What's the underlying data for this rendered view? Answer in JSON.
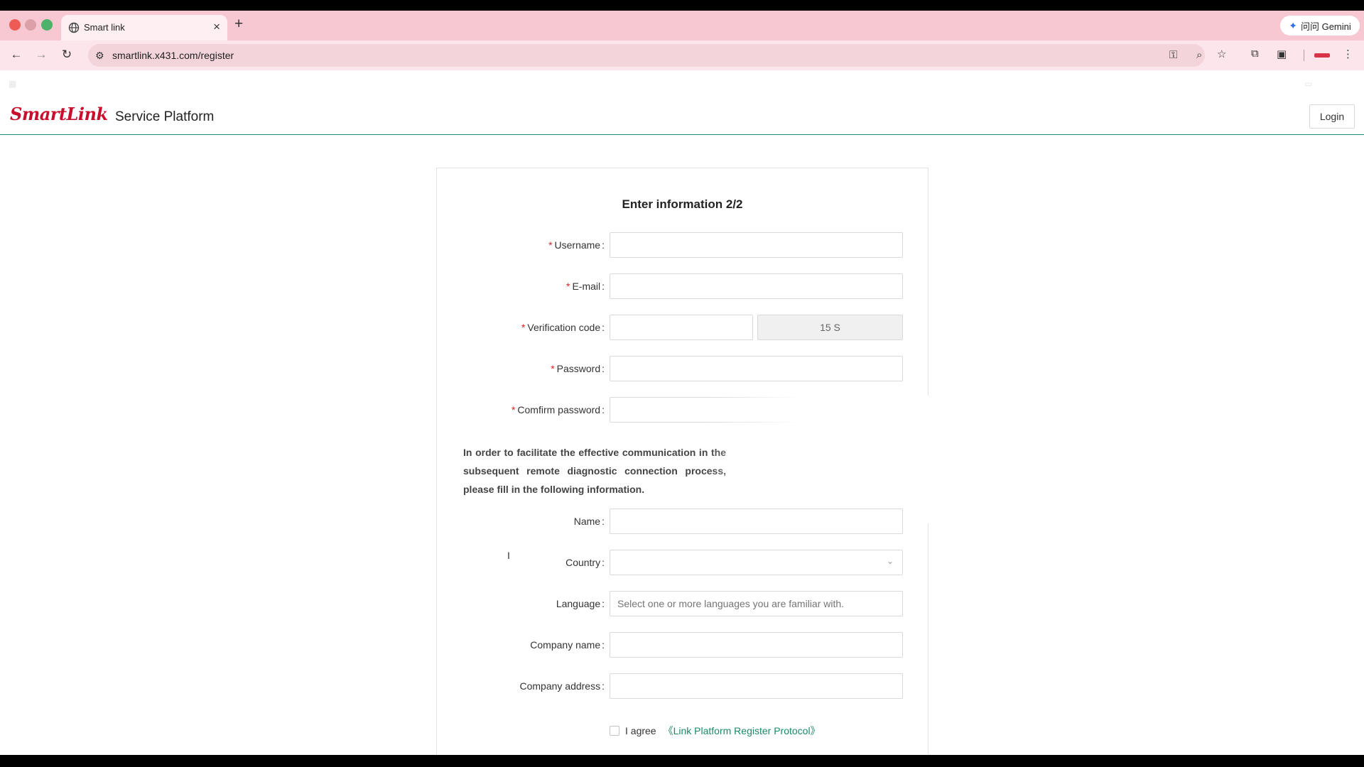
{
  "browser": {
    "tab_title": "Smart link",
    "url": "smartlink.x431.com/register",
    "gemini_label": "问问 Gemini",
    "icons": {
      "favicon": "globe-icon",
      "close": "close-icon",
      "new_tab": "plus-icon",
      "back": "back-arrow-icon",
      "forward": "forward-arrow-icon",
      "reload": "reload-icon",
      "site_settings": "tune-icon",
      "password": "key-icon",
      "zoom": "zoom-icon",
      "bookmark": "star-icon",
      "menu": "kebab-icon"
    }
  },
  "header": {
    "logo": "SmartLink",
    "platform": "Service Platform",
    "login_label": "Login"
  },
  "form": {
    "title": "Enter information 2/2",
    "username_label": "Username",
    "email_label": "E-mail",
    "code_label": "Verification code",
    "code_button": "15 S",
    "password_label": "Password",
    "confirm_label": "Comfirm password",
    "notice": "In order to facilitate the effective communication in the subsequent remote diagnostic connection process, please fill in the following information.",
    "name_label": "Name",
    "country_label": "Country",
    "language_label": "Language",
    "language_placeholder": "Select one or more languages you are familiar with.",
    "company_name_label": "Company name",
    "company_address_label": "Company address",
    "agree_label": "I agree",
    "protocol_link": "《Link Platform Register Protocol》"
  },
  "colors": {
    "brand_red": "#c8102e",
    "accent_green": "#1b8a6b",
    "required_red": "#e02020",
    "tabbar_pink": "#f8c8d2"
  }
}
